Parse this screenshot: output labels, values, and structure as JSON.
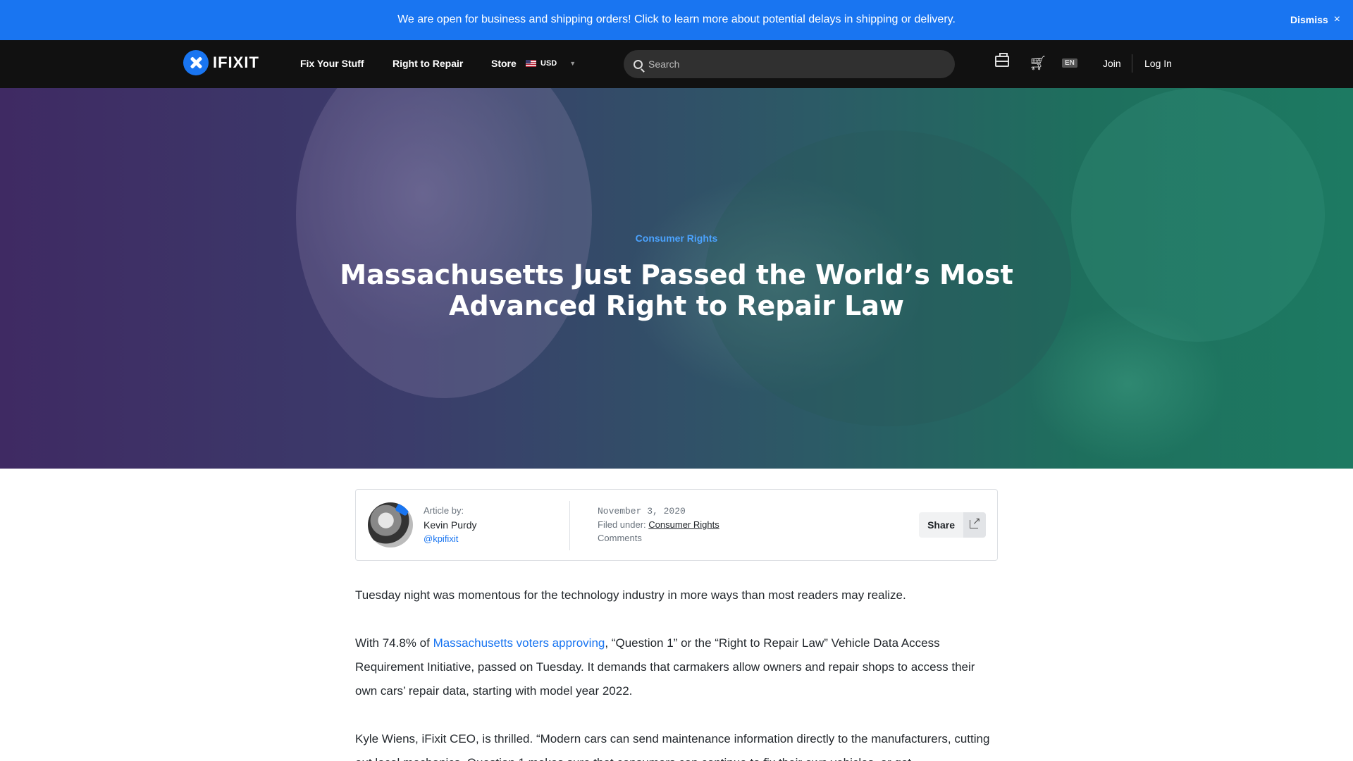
{
  "banner": {
    "text": "We are open for business and shipping orders! Click to learn more about potential delays in shipping or delivery.",
    "dismiss_label": "Dismiss"
  },
  "header": {
    "logo_text": "IFIXIT",
    "nav": {
      "fix_your_stuff": "Fix Your Stuff",
      "right_to_repair": "Right to Repair",
      "store": "Store"
    },
    "currency": "USD",
    "search_placeholder": "Search",
    "language": "EN",
    "join": "Join",
    "login": "Log In"
  },
  "hero": {
    "category": "Consumer Rights",
    "title": "Massachusetts Just Passed the World’s Most Advanced Right to Repair Law"
  },
  "author_card": {
    "label": "Article by:",
    "name": "Kevin Purdy",
    "handle": "@kpifixit",
    "date": "November 3, 2020",
    "filed_label": "Filed under:",
    "filed_category": "Consumer Rights",
    "comments": "Comments",
    "share": "Share"
  },
  "article": {
    "p1": "Tuesday night was momentous for the technology industry in more ways than most readers may realize.",
    "p2_prefix": "With 74.8% of ",
    "p2_link": "Massachusetts voters approving",
    "p2_suffix": ", “Question 1” or the “Right to Repair Law” Vehicle Data Access Requirement Initiative, passed on Tuesday. It demands that carmakers allow owners and repair shops to access their own cars’ repair data, starting with model year 2022.",
    "p3": "Kyle Wiens, iFixit CEO, is thrilled. “Modern cars can send maintenance information directly to the manufacturers, cutting out local mechanics. Question 1 makes sure that consumers can continue to fix their own vehicles, or get"
  },
  "colors": {
    "accent": "#1975f1",
    "header_bg": "#111111"
  }
}
